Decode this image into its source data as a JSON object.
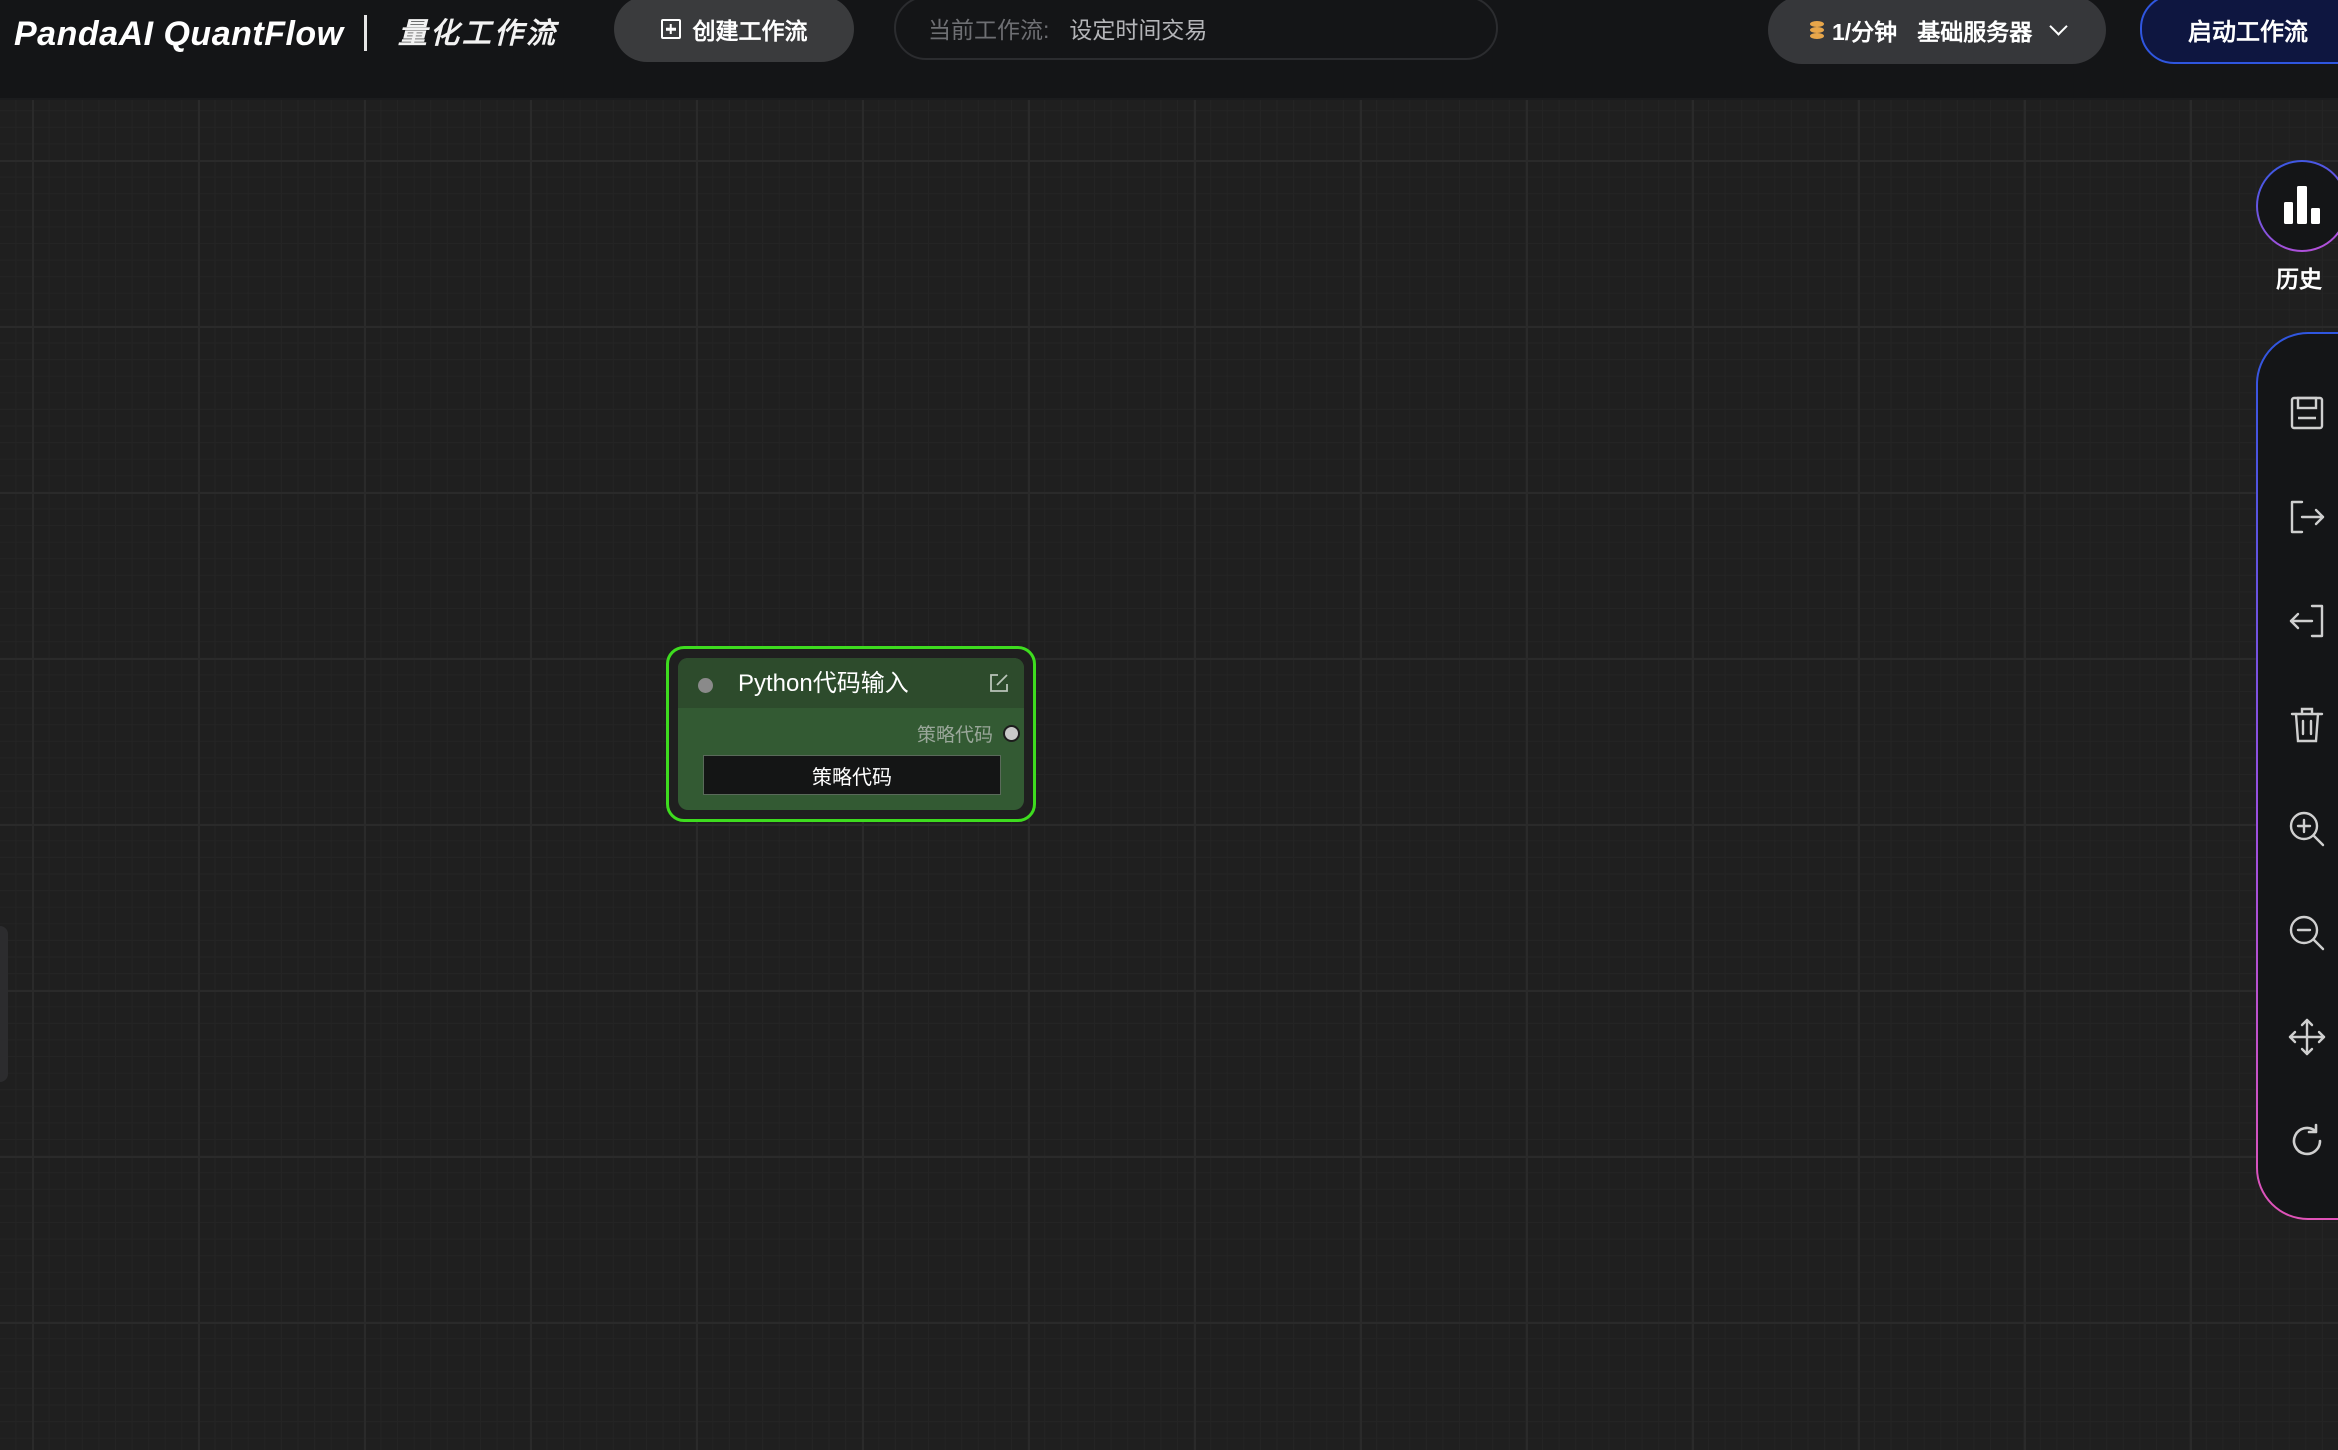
{
  "header": {
    "brand": "PandaAI QuantFlow",
    "subtitle": "量化工作流",
    "create_label": "创建工作流",
    "current_workflow_label": "当前工作流:",
    "current_workflow_name": "设定时间交易",
    "server_rate": "1/分钟",
    "server_name": "基础服务器",
    "start_label": "启动工作流"
  },
  "node": {
    "title": "Python代码输入",
    "output_port_label": "策略代码",
    "field_label": "策略代码",
    "border_color": "#3edc1f",
    "header_color": "#2d4b2c",
    "body_color": "#335a33"
  },
  "sidebar": {
    "history_label": "历史",
    "tools": [
      {
        "icon": "save-icon"
      },
      {
        "icon": "export-icon"
      },
      {
        "icon": "import-icon"
      },
      {
        "icon": "trash-icon"
      },
      {
        "icon": "zoom-in-icon"
      },
      {
        "icon": "zoom-out-icon"
      },
      {
        "icon": "fit-view-icon"
      },
      {
        "icon": "refresh-icon"
      }
    ]
  },
  "colors": {
    "background": "#1f1f1f",
    "header": "#141517",
    "accent_blue": "#2f56e0",
    "accent_pink": "#e053b8",
    "coin": "#e8a64a"
  }
}
